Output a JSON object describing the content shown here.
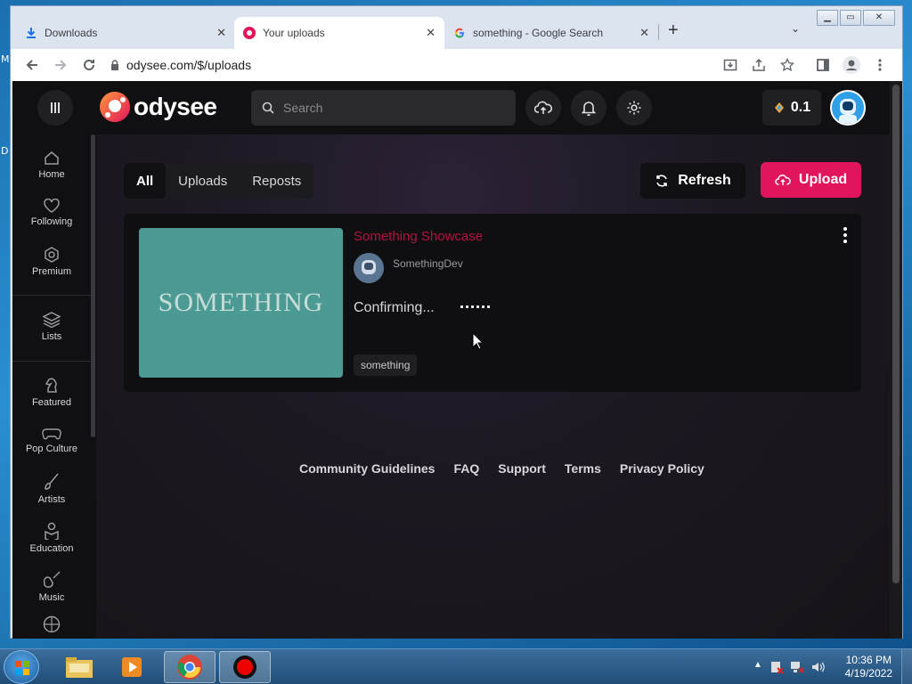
{
  "desktop": {
    "labels": [
      "M",
      "D"
    ]
  },
  "browser": {
    "tabs": [
      {
        "title": "Downloads",
        "icon": "download-icon",
        "active": false
      },
      {
        "title": "Your uploads",
        "icon": "odysee-icon",
        "active": true
      },
      {
        "title": "something - Google Search",
        "icon": "google-icon",
        "active": false
      }
    ],
    "new_tab": "+",
    "url": "odysee.com/$/uploads"
  },
  "header": {
    "logo_text": "odysee",
    "search_placeholder": "Search",
    "credits": "0.1"
  },
  "sidebar": {
    "items": [
      {
        "label": "Home",
        "icon": "home-icon"
      },
      {
        "label": "Following",
        "icon": "heart-icon"
      },
      {
        "label": "Premium",
        "icon": "premium-icon"
      },
      {
        "label": "Lists",
        "icon": "layers-icon"
      },
      {
        "label": "Featured",
        "icon": "chess-knight-icon"
      },
      {
        "label": "Pop Culture",
        "icon": "gamepad-icon"
      },
      {
        "label": "Artists",
        "icon": "brush-icon"
      },
      {
        "label": "Education",
        "icon": "education-icon"
      },
      {
        "label": "Music",
        "icon": "guitar-icon"
      }
    ]
  },
  "filters": {
    "all": "All",
    "uploads": "Uploads",
    "reposts": "Reposts"
  },
  "actions": {
    "refresh": "Refresh",
    "upload": "Upload"
  },
  "upload_card": {
    "thumbnail_text": "SOMETHING",
    "title": "Something Showcase",
    "channel": "SomethingDev",
    "status": "Confirming...",
    "tag": "something"
  },
  "footer": {
    "links": [
      "Community Guidelines",
      "FAQ",
      "Support",
      "Terms",
      "Privacy Policy"
    ]
  },
  "taskbar": {
    "time": "10:36 PM",
    "date": "4/19/2022"
  },
  "colors": {
    "brand_pink": "#e2145c",
    "title_red": "#b3133f",
    "thumbnail_teal": "#4b9a94",
    "page_bg": "#1c1821"
  }
}
